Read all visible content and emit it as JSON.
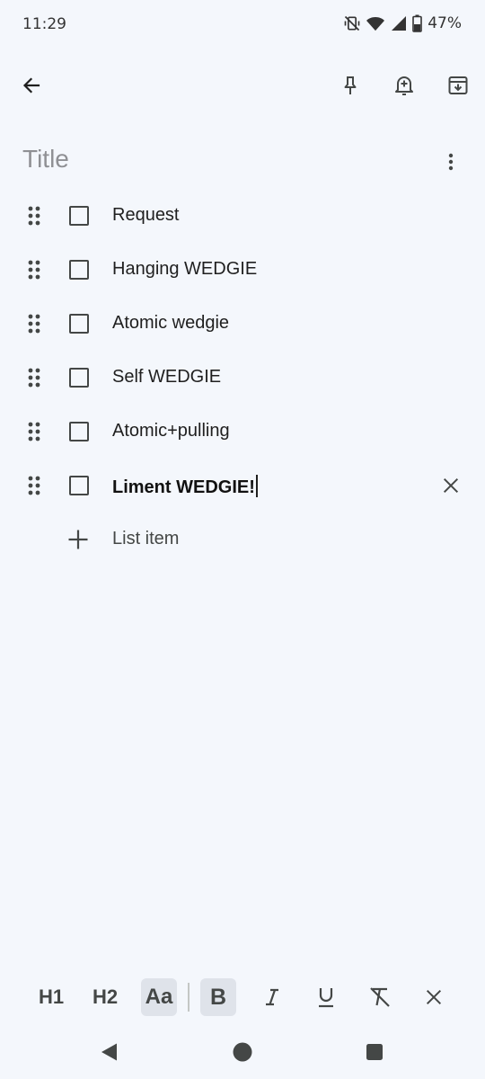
{
  "status_bar": {
    "time": "11:29",
    "battery_percent": "47%",
    "icons": [
      "mute-vibrate-icon",
      "wifi-icon",
      "signal-icon",
      "battery-icon"
    ]
  },
  "toolbar": {
    "back_icon": "arrow-back-icon",
    "pin_icon": "pin-icon",
    "reminder_icon": "add-alert-icon",
    "archive_icon": "archive-icon"
  },
  "note": {
    "title_placeholder": "Title",
    "more_icon": "more-vert-icon",
    "items": [
      {
        "text": "Request",
        "checked": false
      },
      {
        "text": "Hanging WEDGIE",
        "checked": false
      },
      {
        "text": "Atomic wedgie",
        "checked": false
      },
      {
        "text": "Self WEDGIE",
        "checked": false
      },
      {
        "text": "Atomic+pulling",
        "checked": false
      },
      {
        "text": "Liment WEDGIE!",
        "checked": false,
        "focused": true
      }
    ],
    "add_item_label": "List item"
  },
  "format_bar": {
    "h1": "H1",
    "h2": "H2",
    "normal_text": "Aa",
    "bold": "B",
    "selected": [
      "Aa",
      "B"
    ]
  },
  "nav": {
    "back": "nav-back-icon",
    "home": "nav-home-icon",
    "recents": "nav-recents-icon"
  }
}
